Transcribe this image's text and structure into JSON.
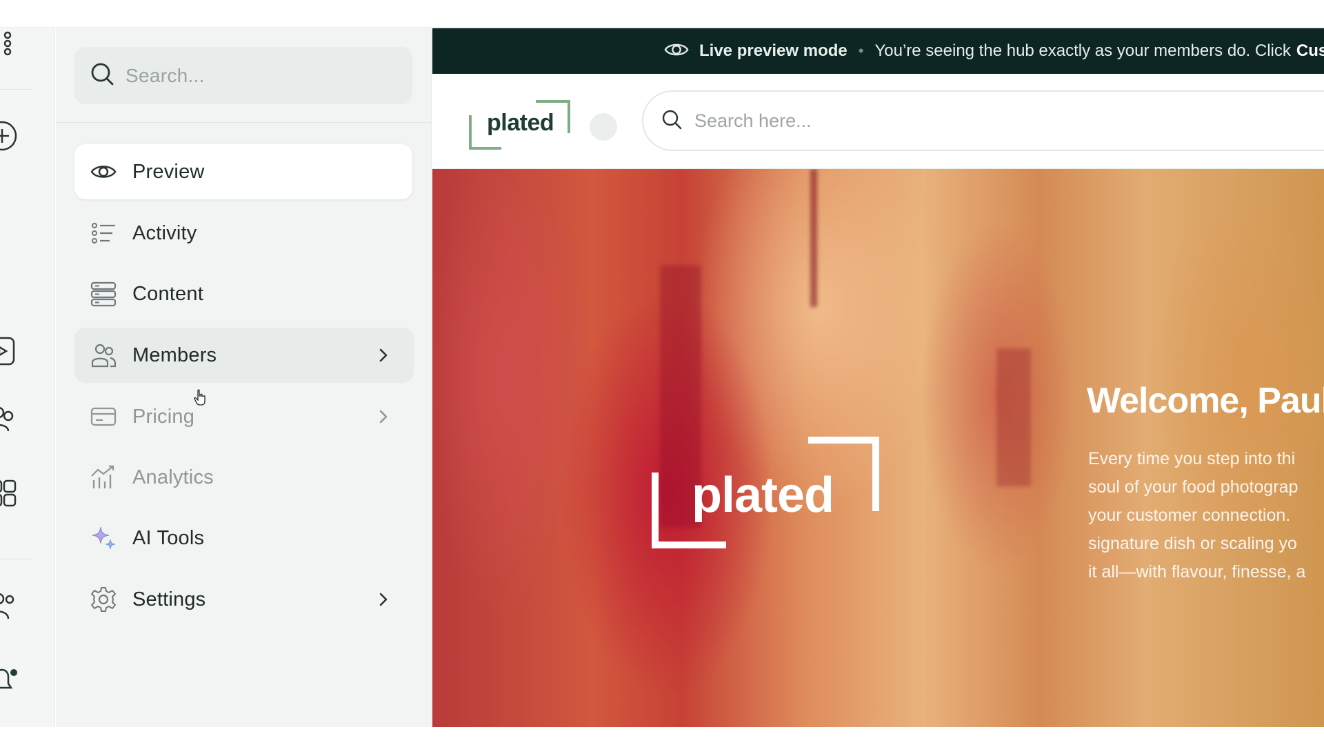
{
  "sidebar": {
    "search_placeholder": "Search...",
    "items": [
      {
        "label": "Preview",
        "icon": "eye-icon",
        "state": "active",
        "has_chevron": false
      },
      {
        "label": "Activity",
        "icon": "activity-list-icon",
        "state": "default",
        "has_chevron": false
      },
      {
        "label": "Content",
        "icon": "content-stack-icon",
        "state": "default",
        "has_chevron": false
      },
      {
        "label": "Members",
        "icon": "members-icon",
        "state": "hover",
        "has_chevron": true
      },
      {
        "label": "Pricing",
        "icon": "credit-card-icon",
        "state": "muted",
        "has_chevron": true
      },
      {
        "label": "Analytics",
        "icon": "analytics-chart-icon",
        "state": "muted",
        "has_chevron": false
      },
      {
        "label": "AI Tools",
        "icon": "sparkle-icon",
        "state": "default",
        "has_chevron": false
      },
      {
        "label": "Settings",
        "icon": "gear-icon",
        "state": "default",
        "has_chevron": true
      }
    ]
  },
  "rail": {
    "icons": [
      "grid-dots-icon",
      "add-circle-icon",
      "video-icon",
      "people-icon",
      "apps-grid-icon",
      "team-icon",
      "notification-bell-icon"
    ]
  },
  "banner": {
    "mode_label": "Live preview mode",
    "separator": "•",
    "message": "You’re seeing the hub exactly as your members do. Click",
    "cta": "Cust"
  },
  "hub": {
    "logo_text": "plated",
    "search_placeholder": "Search here...",
    "hero": {
      "logo_text": "plated",
      "welcome": "Welcome, Paul",
      "body_lines": [
        "Every time you step into thi",
        "soul of your food photograp",
        "your customer connection.",
        "signature dish or scaling yo",
        "it all—with flavour, finesse, a"
      ]
    }
  },
  "colors": {
    "banner_bg": "#0d2523",
    "brand_green": "#1e3d33",
    "logo_bracket_green": "#7fae86",
    "sidebar_bg": "#f1f4f3",
    "active_item_bg": "#ffffff"
  }
}
